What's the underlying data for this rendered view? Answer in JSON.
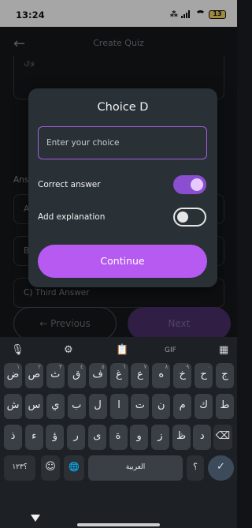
{
  "status": {
    "time": "13:24",
    "battery": "13"
  },
  "header": {
    "title": "Create Quiz"
  },
  "question": {
    "text": "وي"
  },
  "answers": {
    "label": "Ans",
    "rows": [
      "A",
      "B",
      "C)  Third Answer"
    ]
  },
  "nav": {
    "previous": "←  Previous",
    "next": "Next"
  },
  "dialog": {
    "title": "Choice D",
    "input_placeholder": "Enter your choice",
    "correct_label": "Correct answer",
    "correct_on": true,
    "explanation_label": "Add explanation",
    "explanation_on": false,
    "continue": "Continue"
  },
  "keyboard": {
    "tools": {
      "mic": "🎙",
      "settings": "⚙",
      "clipboard": "📋",
      "gif": "GIF",
      "grid": "▦"
    },
    "row1": [
      {
        "k": "ض",
        "h": "١"
      },
      {
        "k": "ص",
        "h": "٢"
      },
      {
        "k": "ث",
        "h": "٣"
      },
      {
        "k": "ق",
        "h": "٤"
      },
      {
        "k": "ف",
        "h": "٥"
      },
      {
        "k": "غ",
        "h": "٦"
      },
      {
        "k": "ع",
        "h": "٧"
      },
      {
        "k": "ه",
        "h": "٨"
      },
      {
        "k": "خ",
        "h": "٩"
      },
      {
        "k": "ح",
        "h": "٠"
      },
      {
        "k": "ج",
        "h": ""
      }
    ],
    "row2": [
      "ش",
      "س",
      "ي",
      "ب",
      "ل",
      "ا",
      "ت",
      "ن",
      "م",
      "ك",
      "ط"
    ],
    "row3": [
      "ذ",
      "ء",
      "ؤ",
      "ر",
      "ى",
      "ة",
      "و",
      "ز",
      "ظ",
      "د"
    ],
    "row4": {
      "numbers": "؟١٢٣",
      "emoji": "☺",
      "globe": "🌐",
      "space": "العربية",
      "period": "؟",
      "enter": "✓",
      "backspace": "⌫"
    }
  }
}
